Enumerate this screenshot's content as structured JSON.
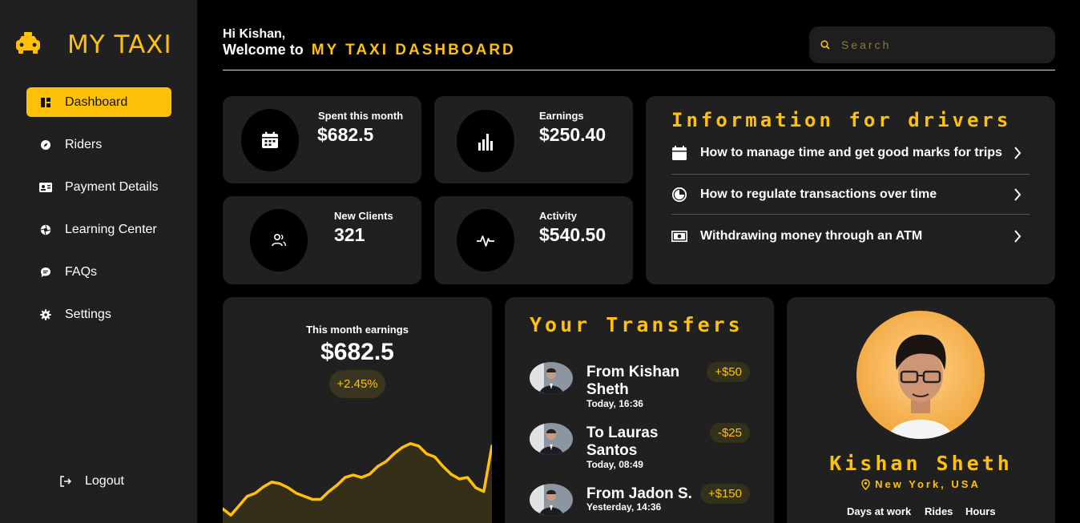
{
  "brand": {
    "name": "MY TAXI",
    "accent": "#ffc107"
  },
  "sidebar": {
    "items": [
      {
        "label": "Dashboard",
        "icon": "dashboard-icon",
        "active": true
      },
      {
        "label": "Riders",
        "icon": "compass-icon"
      },
      {
        "label": "Payment Details",
        "icon": "id-card-icon"
      },
      {
        "label": "Learning Center",
        "icon": "aperture-icon"
      },
      {
        "label": "FAQs",
        "icon": "chat-icon"
      },
      {
        "label": "Settings",
        "icon": "gear-icon"
      }
    ],
    "logout": "Logout"
  },
  "header": {
    "greeting": "Hi Kishan,",
    "welcome": "Welcome to",
    "highlight": "MY TAXI DASHBOARD",
    "search_placeholder": "Search"
  },
  "stats": [
    {
      "title": "Spent this month",
      "value": "$682.5",
      "icon": "calendar-icon"
    },
    {
      "title": "Earnings",
      "value": "$250.40",
      "icon": "bar-chart-icon"
    },
    {
      "title": "New Clients",
      "value": "321",
      "icon": "users-icon"
    },
    {
      "title": "Activity",
      "value": "$540.50",
      "icon": "pulse-icon"
    }
  ],
  "info": {
    "title": "Information for drivers",
    "items": [
      {
        "text": "How to manage time and get good marks for trips",
        "icon": "calendar-icon"
      },
      {
        "text": "How to regulate transactions over time",
        "icon": "clock-icon"
      },
      {
        "text": "Withdrawing money through an ATM",
        "icon": "money-icon"
      }
    ]
  },
  "earnings": {
    "title": "This month earnings",
    "value": "$682.5",
    "change": "+2.45%"
  },
  "chart_data": {
    "type": "area",
    "values": [
      18,
      10,
      22,
      34,
      38,
      46,
      52,
      50,
      45,
      38,
      34,
      30,
      30,
      40,
      48,
      58,
      61,
      58,
      62,
      72,
      78,
      88,
      96,
      101,
      98,
      88,
      84,
      72,
      62,
      56,
      58,
      45,
      40,
      98
    ],
    "color": "#ffc107"
  },
  "transfers": {
    "title": "Your Transfers",
    "items": [
      {
        "name": "From Kishan Sheth",
        "time": "Today, 16:36",
        "amount": "+$50"
      },
      {
        "name": "To Lauras Santos",
        "time": "Today, 08:49",
        "amount": "-$25"
      },
      {
        "name": "From Jadon S.",
        "time": "Yesterday, 14:36",
        "amount": "+$150"
      }
    ]
  },
  "profile": {
    "name": "Kishan Sheth",
    "location": "New York, USA",
    "stats_labels": [
      "Days at work",
      "Rides",
      "Hours"
    ]
  }
}
